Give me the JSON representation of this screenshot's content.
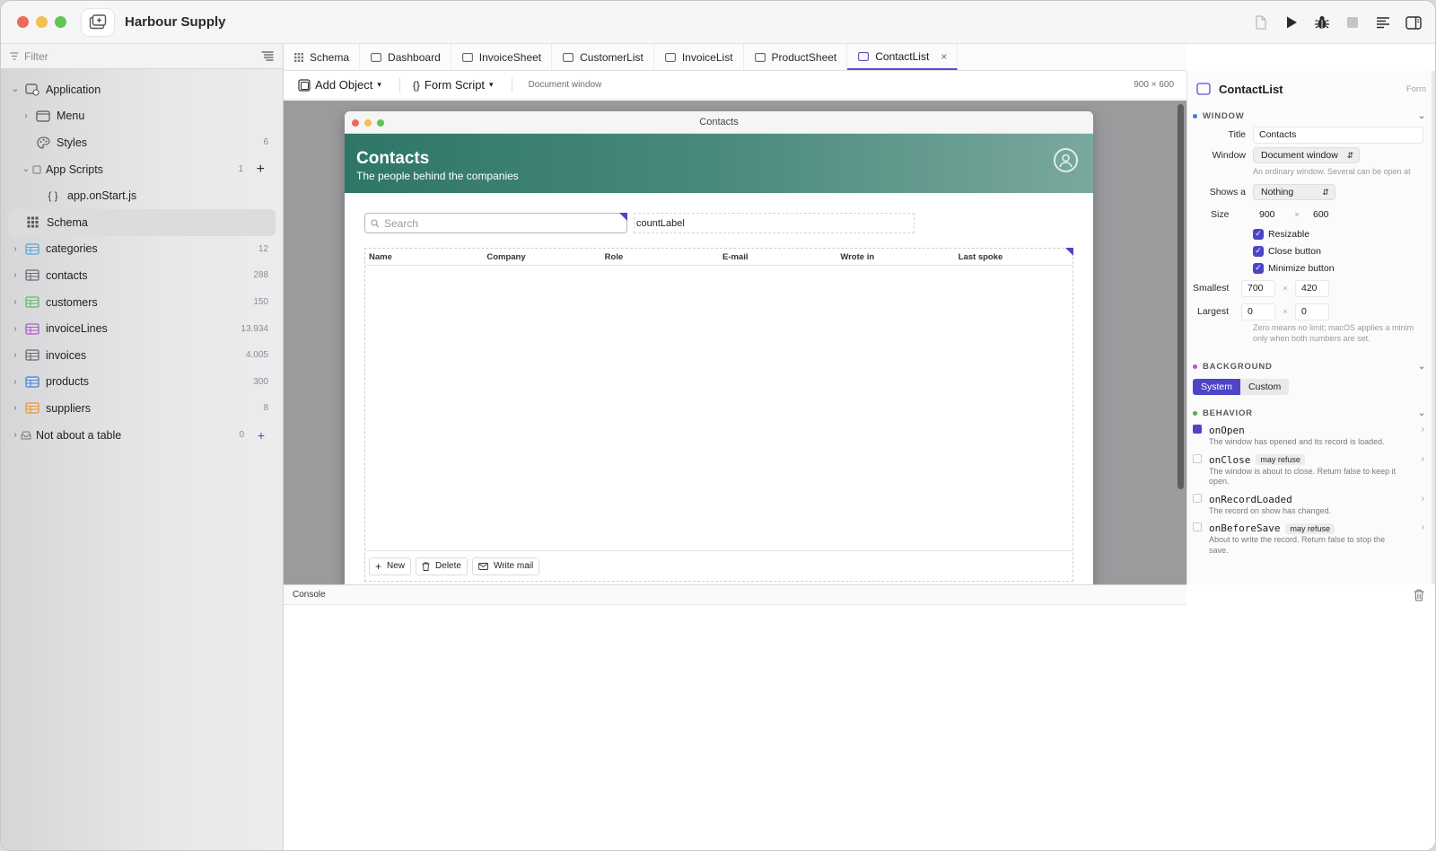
{
  "app": {
    "title": "Harbour Supply"
  },
  "sidebar": {
    "filter_placeholder": "Filter",
    "tree": [
      {
        "label": "Application",
        "icon": "app-icon",
        "chevron": "down",
        "count": ""
      },
      {
        "label": "Menu",
        "icon": "window-icon",
        "chevron": "right",
        "count": ""
      },
      {
        "label": "Styles",
        "icon": "palette-icon",
        "chevron": "",
        "count": "6"
      },
      {
        "label": "App Scripts",
        "icon": "script-icon",
        "chevron": "down",
        "count": "1"
      },
      {
        "label": "app.onStart.js",
        "icon": "braces-icon",
        "chevron": "",
        "count": ""
      },
      {
        "label": "Schema",
        "icon": "grid-icon",
        "chevron": "",
        "count": ""
      },
      {
        "label": "categories",
        "icon": "table-icon",
        "chevron": "right",
        "count": "12",
        "color": "#5aa7d6"
      },
      {
        "label": "contacts",
        "icon": "table-icon",
        "chevron": "right",
        "count": "288",
        "color": "#6b6b70"
      },
      {
        "label": "customers",
        "icon": "table-icon",
        "chevron": "right",
        "count": "150",
        "color": "#67b86b"
      },
      {
        "label": "invoiceLines",
        "icon": "table-icon",
        "chevron": "right",
        "count": "13.934",
        "color": "#b25ac8"
      },
      {
        "label": "invoices",
        "icon": "table-icon",
        "chevron": "right",
        "count": "4.005",
        "color": "#6b6b70"
      },
      {
        "label": "products",
        "icon": "table-icon",
        "chevron": "right",
        "count": "300",
        "color": "#4a82d6"
      },
      {
        "label": "suppliers",
        "icon": "table-icon",
        "chevron": "right",
        "count": "8",
        "color": "#e69a3c"
      },
      {
        "label": "Not about a table",
        "icon": "tray-icon",
        "chevron": "right",
        "count": "0"
      }
    ]
  },
  "tabs": [
    {
      "label": "Schema",
      "icon": "grid-icon"
    },
    {
      "label": "Dashboard",
      "icon": "window-icon"
    },
    {
      "label": "InvoiceSheet",
      "icon": "window-icon"
    },
    {
      "label": "CustomerList",
      "icon": "window-icon"
    },
    {
      "label": "InvoiceList",
      "icon": "window-icon"
    },
    {
      "label": "ProductSheet",
      "icon": "window-icon"
    },
    {
      "label": "ContactList",
      "icon": "window-icon",
      "active": true
    }
  ],
  "toolbar": {
    "add_object": "Add Object",
    "form_script": "Form Script",
    "doc_hint": "Document window",
    "size_hint": "900 × 600"
  },
  "form": {
    "window_title": "Contacts",
    "header_title": "Contacts",
    "header_subtitle": "The people behind the companies",
    "search_placeholder": "Search",
    "count_label": "countLabel",
    "columns": [
      "Name",
      "Company",
      "Role",
      "E-mail",
      "Wrote in",
      "Last spoke"
    ],
    "buttons": {
      "new": "New",
      "delete": "Delete",
      "write_mail": "Write mail"
    },
    "header_colors": [
      "#2e7668",
      "#7aa89e"
    ]
  },
  "console": {
    "label": "Console"
  },
  "inspector": {
    "title": "ContactList",
    "kind": "Form",
    "window_section": "WINDOW",
    "title_label": "Title",
    "title_value": "Contacts",
    "window_label": "Window",
    "window_value": "Document window",
    "window_hint": "An ordinary window. Several can be open at",
    "shows_label": "Shows a",
    "shows_value": "Nothing",
    "size_label": "Size",
    "size_w": "900",
    "size_h": "600",
    "resizable": "Resizable",
    "close_button": "Close button",
    "minimize_button": "Minimize button",
    "smallest_label": "Smallest",
    "smallest_w": "700",
    "smallest_h": "420",
    "largest_label": "Largest",
    "largest_w": "0",
    "largest_h": "0",
    "limit_hint_1": "Zero means no limit; macOS applies a minim",
    "limit_hint_2": "only when both numbers are set.",
    "background_section": "BACKGROUND",
    "bg_system": "System",
    "bg_custom": "Custom",
    "behavior_section": "BEHAVIOR",
    "events": [
      {
        "name": "onOpen",
        "badge": "",
        "desc": "The window has opened and its record is loaded.",
        "active": true
      },
      {
        "name": "onClose",
        "badge": "may refuse",
        "desc": "The window is about to close. Return false to keep it open.",
        "active": false
      },
      {
        "name": "onRecordLoaded",
        "badge": "",
        "desc": "The record on show has changed.",
        "active": false
      },
      {
        "name": "onBeforeSave",
        "badge": "may refuse",
        "desc": "About to write the record. Return false to stop the save.",
        "active": false
      }
    ],
    "accent": "#4e44c8"
  }
}
